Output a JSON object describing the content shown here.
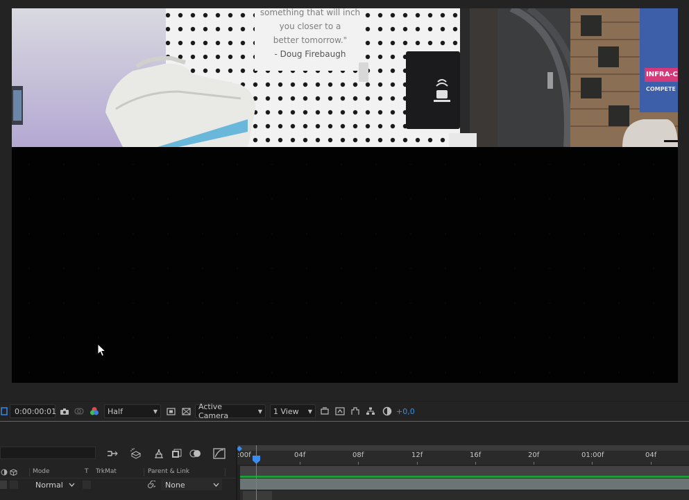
{
  "footage": {
    "quote_line1": "something that will inch",
    "quote_line2": "you closer to a",
    "quote_line3": "better tomorrow.\"",
    "quote_author": "- Doug Firebaugh",
    "sign_text1": "INFRA-C",
    "sign_text2": "COMPETE"
  },
  "viewer_toolbar": {
    "timecode": "0:00:00:01",
    "resolution": "Half",
    "camera": "Active Camera",
    "views": "1 View",
    "exposure": "+0,0"
  },
  "timeline": {
    "ruler_labels": [
      ":00f",
      "04f",
      "08f",
      "12f",
      "16f",
      "20f",
      "01:00f",
      "04f"
    ],
    "columns": {
      "mode": "Mode",
      "t": "T",
      "trkmat": "TrkMat",
      "parent_link": "Parent & Link"
    },
    "layer": {
      "mode": "Normal",
      "parent": "None"
    }
  },
  "colors": {
    "accent_blue": "#2d6fd6",
    "cti_blue": "#3a8cf0",
    "green_bar": "#1e9d3c",
    "layer_bar": "#6c7576"
  }
}
